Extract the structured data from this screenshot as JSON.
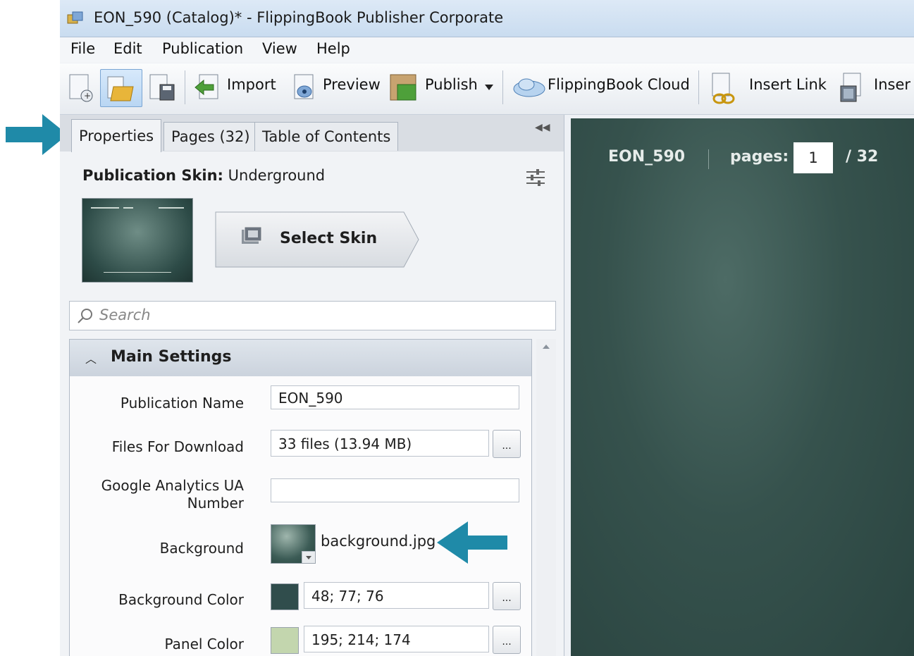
{
  "window": {
    "title": "EON_590 (Catalog)* - FlippingBook Publisher Corporate"
  },
  "menu": [
    "File",
    "Edit",
    "Publication",
    "View",
    "Help"
  ],
  "toolbar": {
    "import_label": "Import",
    "preview_label": "Preview",
    "publish_label": "Publish",
    "cloud_label": "FlippingBook Cloud",
    "insert_link_label": "Insert Link",
    "insert_more_label": "Inser"
  },
  "tabs": {
    "properties": "Properties",
    "pages": "Pages (32)",
    "toc": "Table of Contents"
  },
  "skin": {
    "label": "Publication Skin:",
    "value": "Underground",
    "select_label": "Select Skin"
  },
  "search": {
    "placeholder": "Search"
  },
  "section": {
    "title": "Main Settings"
  },
  "settings": {
    "publication_name_label": "Publication Name",
    "publication_name_value": "EON_590",
    "files_label": "Files For Download",
    "files_value": "33 files (13.94 MB)",
    "ga_label_1": "Google Analytics UA",
    "ga_label_2": "Number",
    "ga_value": "",
    "background_label": "Background",
    "background_file": "background.jpg",
    "bg_color_label": "Background Color",
    "bg_color_value": "48; 77; 76",
    "bg_color_hex": "#304d4c",
    "panel_color_label": "Panel Color",
    "panel_color_value": "195; 214; 174",
    "panel_color_hex": "#c3d6ae",
    "dots": "..."
  },
  "preview": {
    "title": "EON_590",
    "pages_label": "pages:",
    "current_page": "1",
    "total": "/ 32"
  },
  "annotations": {
    "arrow_color": "#1f8aa8"
  }
}
